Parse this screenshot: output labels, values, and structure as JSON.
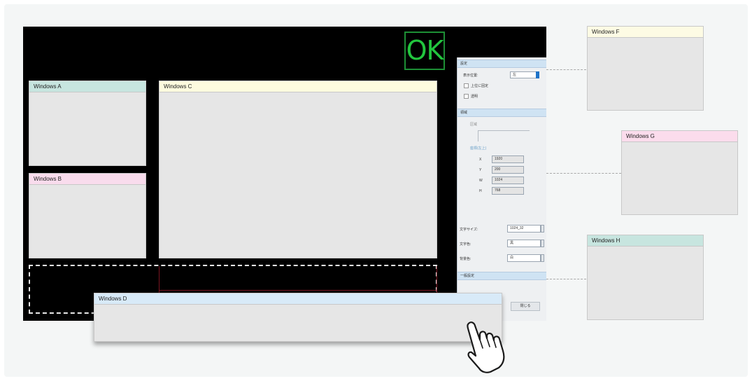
{
  "ok_label": "OK",
  "windows": {
    "a": {
      "title": "Windows A",
      "color": "#c7e5df"
    },
    "b": {
      "title": "Windows B",
      "color": "#f9dced"
    },
    "c": {
      "title": "Windows C",
      "color": "#fdfbdf"
    },
    "d": {
      "title": "Windows D",
      "color": "#d8eaf8"
    },
    "f": {
      "title": "Windows F",
      "color": "#fdfbe4"
    },
    "g": {
      "title": "Windows G",
      "color": "#fbdcec"
    },
    "h": {
      "title": "Windows H",
      "color": "#c7e5df"
    }
  },
  "panel": {
    "section1": "設定",
    "display_pos_label": "表示位置:",
    "display_pos_value": "左",
    "check1": "上位に固定",
    "check2": "透明",
    "section2": "領域",
    "group_label": "区域",
    "coords_label": "座標(左上)",
    "x_label": "X",
    "x_value": "1920",
    "y_label": "Y",
    "y_value": "200",
    "w_label": "W",
    "w_value": "1024",
    "h_label": "H",
    "h_value": "768",
    "font_size_label": "文字サイズ:",
    "font_size_value": "1024_32",
    "font_color_label": "文字色:",
    "font_color_value": "黒",
    "bg_color_label": "背景色:",
    "bg_color_value": "白",
    "section3": "一般設定",
    "close_button": "閉じる"
  },
  "colors": {
    "screen": "#000000",
    "ok_green": "#22c53e",
    "accent_blue": "#1e73c8"
  }
}
